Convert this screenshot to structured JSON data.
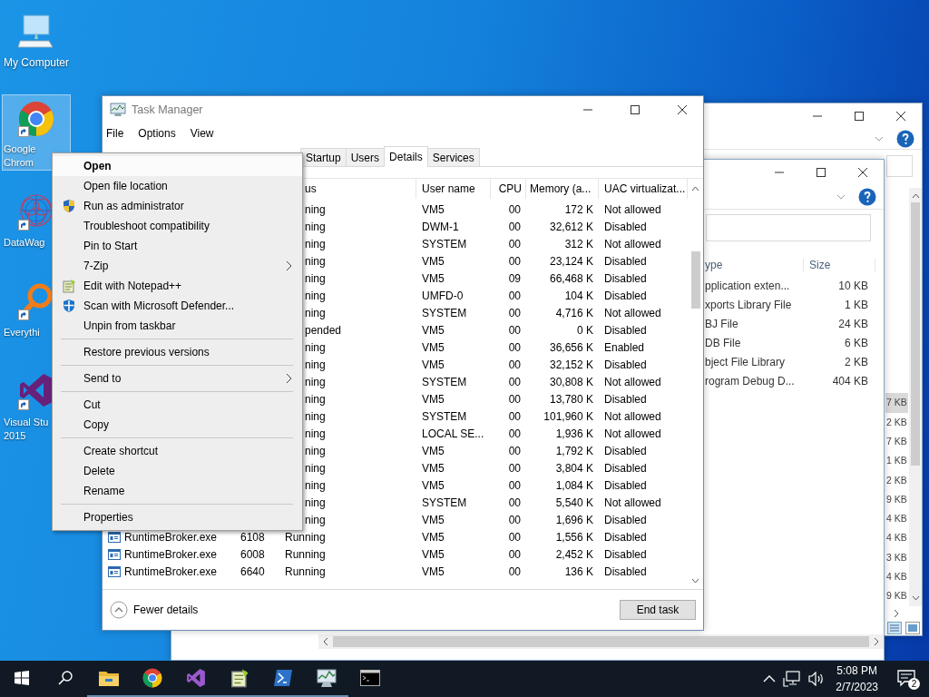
{
  "desktop_icons": [
    {
      "kind": "computer",
      "lines": [
        "My Computer"
      ],
      "shortcut": false,
      "selected": false
    },
    {
      "kind": "chrome",
      "lines": [
        "Google",
        "Chrom"
      ],
      "shortcut": true,
      "selected": true
    },
    {
      "kind": "mesh",
      "lines": [
        "DataWag"
      ],
      "shortcut": true,
      "selected": false
    },
    {
      "kind": "magnifier",
      "lines": [
        "Everythi"
      ],
      "shortcut": true,
      "selected": false
    },
    {
      "kind": "studio",
      "lines": [
        "Visual Stu",
        "2015"
      ],
      "shortcut": true,
      "selected": false
    }
  ],
  "back_explorer": {
    "sizes": [
      {
        "text": "7 KB",
        "selected": true
      },
      {
        "text": "2 KB",
        "selected": false
      },
      {
        "text": "7 KB",
        "selected": false
      },
      {
        "text": "1 KB",
        "selected": false
      },
      {
        "text": "2 KB",
        "selected": false
      },
      {
        "text": "9 KB",
        "selected": false
      },
      {
        "text": "4 KB",
        "selected": false
      },
      {
        "text": "4 KB",
        "selected": false
      },
      {
        "text": "3 KB",
        "selected": false
      },
      {
        "text": "4 KB",
        "selected": false
      },
      {
        "text": "9 KB",
        "selected": false
      }
    ]
  },
  "front_explorer": {
    "columns": [
      "ype",
      "Size"
    ],
    "rows": [
      {
        "type": "pplication exten...",
        "size": "10 KB"
      },
      {
        "type": "xports Library File",
        "size": "1 KB"
      },
      {
        "type": "BJ File",
        "size": "24 KB"
      },
      {
        "type": "DB File",
        "size": "6 KB"
      },
      {
        "type": "bject File Library",
        "size": "2 KB"
      },
      {
        "type": "rogram Debug D...",
        "size": "404 KB"
      }
    ]
  },
  "task_manager": {
    "title": "Task Manager",
    "menu": [
      "File",
      "Options",
      "View"
    ],
    "tabs": [
      {
        "label": "Startup",
        "selected": false
      },
      {
        "label": "Users",
        "selected": false
      },
      {
        "label": "Details",
        "selected": true
      },
      {
        "label": "Services",
        "selected": false
      }
    ],
    "columns": [
      "us",
      "User name",
      "CPU",
      "Memory (a...",
      "UAC virtualizat..."
    ],
    "rows": [
      {
        "status": "ning",
        "user": "VM5",
        "cpu": "00",
        "memory": "172 K",
        "uac": "Not allowed"
      },
      {
        "status": "ning",
        "user": "DWM-1",
        "cpu": "00",
        "memory": "32,612 K",
        "uac": "Disabled"
      },
      {
        "status": "ning",
        "user": "SYSTEM",
        "cpu": "00",
        "memory": "312 K",
        "uac": "Not allowed"
      },
      {
        "status": "ning",
        "user": "VM5",
        "cpu": "00",
        "memory": "23,124 K",
        "uac": "Disabled"
      },
      {
        "status": "ning",
        "user": "VM5",
        "cpu": "09",
        "memory": "66,468 K",
        "uac": "Disabled"
      },
      {
        "status": "ning",
        "user": "UMFD-0",
        "cpu": "00",
        "memory": "104 K",
        "uac": "Disabled"
      },
      {
        "status": "ning",
        "user": "SYSTEM",
        "cpu": "00",
        "memory": "4,716 K",
        "uac": "Not allowed"
      },
      {
        "status": "pended",
        "user": "VM5",
        "cpu": "00",
        "memory": "0 K",
        "uac": "Disabled"
      },
      {
        "status": "ning",
        "user": "VM5",
        "cpu": "00",
        "memory": "36,656 K",
        "uac": "Enabled"
      },
      {
        "status": "ning",
        "user": "VM5",
        "cpu": "00",
        "memory": "32,152 K",
        "uac": "Disabled"
      },
      {
        "status": "ning",
        "user": "SYSTEM",
        "cpu": "00",
        "memory": "30,808 K",
        "uac": "Not allowed"
      },
      {
        "status": "ning",
        "user": "VM5",
        "cpu": "00",
        "memory": "13,780 K",
        "uac": "Disabled"
      },
      {
        "status": "ning",
        "user": "SYSTEM",
        "cpu": "00",
        "memory": "101,960 K",
        "uac": "Not allowed"
      },
      {
        "status": "ning",
        "user": "LOCAL SE...",
        "cpu": "00",
        "memory": "1,936 K",
        "uac": "Not allowed"
      },
      {
        "status": "ning",
        "user": "VM5",
        "cpu": "00",
        "memory": "1,792 K",
        "uac": "Disabled"
      },
      {
        "status": "ning",
        "user": "VM5",
        "cpu": "00",
        "memory": "3,804 K",
        "uac": "Disabled"
      },
      {
        "status": "ning",
        "user": "VM5",
        "cpu": "00",
        "memory": "1,084 K",
        "uac": "Disabled"
      },
      {
        "status": "ning",
        "user": "SYSTEM",
        "cpu": "00",
        "memory": "5,540 K",
        "uac": "Not allowed"
      },
      {
        "status": "ning",
        "user": "VM5",
        "cpu": "00",
        "memory": "1,696 K",
        "uac": "Disabled"
      },
      {
        "name": "RuntimeBroker.exe",
        "pid": "6108",
        "status": "Running",
        "user": "VM5",
        "cpu": "00",
        "memory": "1,556 K",
        "uac": "Disabled"
      },
      {
        "name": "RuntimeBroker.exe",
        "pid": "6008",
        "status": "Running",
        "user": "VM5",
        "cpu": "00",
        "memory": "2,452 K",
        "uac": "Disabled"
      },
      {
        "name": "RuntimeBroker.exe",
        "pid": "6640",
        "status": "Running",
        "user": "VM5",
        "cpu": "00",
        "memory": "136 K",
        "uac": "Disabled"
      }
    ],
    "fewer_details": "Fewer details",
    "end_task": "End task"
  },
  "context_menu": {
    "items": [
      {
        "kind": "item",
        "label": "Open",
        "default": true,
        "selected": true,
        "submenu": false
      },
      {
        "kind": "item",
        "label": "Open file location",
        "default": false,
        "selected": false,
        "submenu": false
      },
      {
        "kind": "shield",
        "label": "Run as administrator",
        "default": false,
        "selected": false,
        "submenu": false
      },
      {
        "kind": "item",
        "label": "Troubleshoot compatibility",
        "default": false,
        "selected": false,
        "submenu": false
      },
      {
        "kind": "item",
        "label": "Pin to Start",
        "default": false,
        "selected": false,
        "submenu": false
      },
      {
        "kind": "item",
        "label": "7-Zip",
        "default": false,
        "selected": false,
        "submenu": true
      },
      {
        "kind": "notepad",
        "label": "Edit with Notepad++",
        "default": false,
        "selected": false,
        "submenu": false
      },
      {
        "kind": "defender",
        "label": "Scan with Microsoft Defender...",
        "default": false,
        "selected": false,
        "submenu": false
      },
      {
        "kind": "item",
        "label": "Unpin from taskbar",
        "default": false,
        "selected": false,
        "submenu": false
      },
      {
        "kind": "separator"
      },
      {
        "kind": "item",
        "label": "Restore previous versions",
        "default": false,
        "selected": false,
        "submenu": false
      },
      {
        "kind": "separator"
      },
      {
        "kind": "item",
        "label": "Send to",
        "default": false,
        "selected": false,
        "submenu": true
      },
      {
        "kind": "separator"
      },
      {
        "kind": "item",
        "label": "Cut",
        "default": false,
        "selected": false,
        "submenu": false
      },
      {
        "kind": "item",
        "label": "Copy",
        "default": false,
        "selected": false,
        "submenu": false
      },
      {
        "kind": "separator"
      },
      {
        "kind": "item",
        "label": "Create shortcut",
        "default": false,
        "selected": false,
        "submenu": false
      },
      {
        "kind": "item",
        "label": "Delete",
        "default": false,
        "selected": false,
        "submenu": false
      },
      {
        "kind": "item",
        "label": "Rename",
        "default": false,
        "selected": false,
        "submenu": false
      },
      {
        "kind": "separator"
      },
      {
        "kind": "item",
        "label": "Properties",
        "default": false,
        "selected": false,
        "submenu": false
      }
    ]
  },
  "taskbar": {
    "apps": [
      {
        "kind": "folder",
        "running": true
      },
      {
        "kind": "chrome",
        "running": true
      },
      {
        "kind": "studio",
        "running": true
      },
      {
        "kind": "notepad",
        "running": true
      },
      {
        "kind": "shell",
        "running": true
      },
      {
        "kind": "monitor",
        "running": true
      },
      {
        "kind": "console",
        "running": false
      }
    ],
    "time": "5:08 PM",
    "date": "2/7/2023",
    "notifications": "2"
  }
}
